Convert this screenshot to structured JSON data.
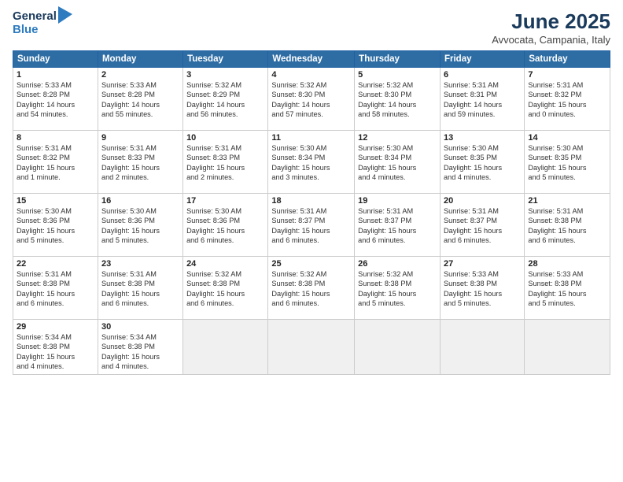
{
  "logo": {
    "general": "General",
    "blue": "Blue"
  },
  "title": "June 2025",
  "location": "Avvocata, Campania, Italy",
  "headers": [
    "Sunday",
    "Monday",
    "Tuesday",
    "Wednesday",
    "Thursday",
    "Friday",
    "Saturday"
  ],
  "weeks": [
    [
      {
        "day": "1",
        "info": "Sunrise: 5:33 AM\nSunset: 8:28 PM\nDaylight: 14 hours\nand 54 minutes."
      },
      {
        "day": "2",
        "info": "Sunrise: 5:33 AM\nSunset: 8:28 PM\nDaylight: 14 hours\nand 55 minutes."
      },
      {
        "day": "3",
        "info": "Sunrise: 5:32 AM\nSunset: 8:29 PM\nDaylight: 14 hours\nand 56 minutes."
      },
      {
        "day": "4",
        "info": "Sunrise: 5:32 AM\nSunset: 8:30 PM\nDaylight: 14 hours\nand 57 minutes."
      },
      {
        "day": "5",
        "info": "Sunrise: 5:32 AM\nSunset: 8:30 PM\nDaylight: 14 hours\nand 58 minutes."
      },
      {
        "day": "6",
        "info": "Sunrise: 5:31 AM\nSunset: 8:31 PM\nDaylight: 14 hours\nand 59 minutes."
      },
      {
        "day": "7",
        "info": "Sunrise: 5:31 AM\nSunset: 8:32 PM\nDaylight: 15 hours\nand 0 minutes."
      }
    ],
    [
      {
        "day": "8",
        "info": "Sunrise: 5:31 AM\nSunset: 8:32 PM\nDaylight: 15 hours\nand 1 minute."
      },
      {
        "day": "9",
        "info": "Sunrise: 5:31 AM\nSunset: 8:33 PM\nDaylight: 15 hours\nand 2 minutes."
      },
      {
        "day": "10",
        "info": "Sunrise: 5:31 AM\nSunset: 8:33 PM\nDaylight: 15 hours\nand 2 minutes."
      },
      {
        "day": "11",
        "info": "Sunrise: 5:30 AM\nSunset: 8:34 PM\nDaylight: 15 hours\nand 3 minutes."
      },
      {
        "day": "12",
        "info": "Sunrise: 5:30 AM\nSunset: 8:34 PM\nDaylight: 15 hours\nand 4 minutes."
      },
      {
        "day": "13",
        "info": "Sunrise: 5:30 AM\nSunset: 8:35 PM\nDaylight: 15 hours\nand 4 minutes."
      },
      {
        "day": "14",
        "info": "Sunrise: 5:30 AM\nSunset: 8:35 PM\nDaylight: 15 hours\nand 5 minutes."
      }
    ],
    [
      {
        "day": "15",
        "info": "Sunrise: 5:30 AM\nSunset: 8:36 PM\nDaylight: 15 hours\nand 5 minutes."
      },
      {
        "day": "16",
        "info": "Sunrise: 5:30 AM\nSunset: 8:36 PM\nDaylight: 15 hours\nand 5 minutes."
      },
      {
        "day": "17",
        "info": "Sunrise: 5:30 AM\nSunset: 8:36 PM\nDaylight: 15 hours\nand 6 minutes."
      },
      {
        "day": "18",
        "info": "Sunrise: 5:31 AM\nSunset: 8:37 PM\nDaylight: 15 hours\nand 6 minutes."
      },
      {
        "day": "19",
        "info": "Sunrise: 5:31 AM\nSunset: 8:37 PM\nDaylight: 15 hours\nand 6 minutes."
      },
      {
        "day": "20",
        "info": "Sunrise: 5:31 AM\nSunset: 8:37 PM\nDaylight: 15 hours\nand 6 minutes."
      },
      {
        "day": "21",
        "info": "Sunrise: 5:31 AM\nSunset: 8:38 PM\nDaylight: 15 hours\nand 6 minutes."
      }
    ],
    [
      {
        "day": "22",
        "info": "Sunrise: 5:31 AM\nSunset: 8:38 PM\nDaylight: 15 hours\nand 6 minutes."
      },
      {
        "day": "23",
        "info": "Sunrise: 5:31 AM\nSunset: 8:38 PM\nDaylight: 15 hours\nand 6 minutes."
      },
      {
        "day": "24",
        "info": "Sunrise: 5:32 AM\nSunset: 8:38 PM\nDaylight: 15 hours\nand 6 minutes."
      },
      {
        "day": "25",
        "info": "Sunrise: 5:32 AM\nSunset: 8:38 PM\nDaylight: 15 hours\nand 6 minutes."
      },
      {
        "day": "26",
        "info": "Sunrise: 5:32 AM\nSunset: 8:38 PM\nDaylight: 15 hours\nand 5 minutes."
      },
      {
        "day": "27",
        "info": "Sunrise: 5:33 AM\nSunset: 8:38 PM\nDaylight: 15 hours\nand 5 minutes."
      },
      {
        "day": "28",
        "info": "Sunrise: 5:33 AM\nSunset: 8:38 PM\nDaylight: 15 hours\nand 5 minutes."
      }
    ],
    [
      {
        "day": "29",
        "info": "Sunrise: 5:34 AM\nSunset: 8:38 PM\nDaylight: 15 hours\nand 4 minutes."
      },
      {
        "day": "30",
        "info": "Sunrise: 5:34 AM\nSunset: 8:38 PM\nDaylight: 15 hours\nand 4 minutes."
      },
      {
        "day": "",
        "info": ""
      },
      {
        "day": "",
        "info": ""
      },
      {
        "day": "",
        "info": ""
      },
      {
        "day": "",
        "info": ""
      },
      {
        "day": "",
        "info": ""
      }
    ]
  ]
}
